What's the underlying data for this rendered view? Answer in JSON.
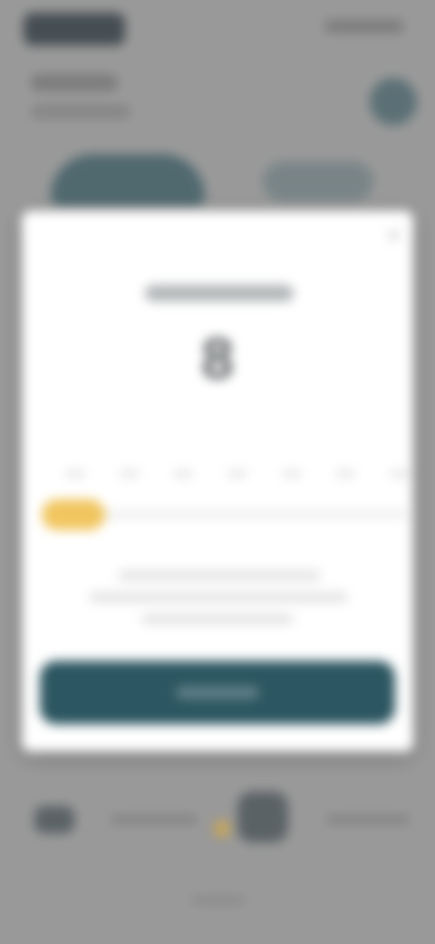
{
  "modal": {
    "value": "8"
  },
  "colors": {
    "primary": "#2c5661",
    "accent": "#f0c04f",
    "modal_bg": "#ffffff",
    "scrim": "#a7a7a7"
  },
  "icons": {
    "close": "close-icon"
  },
  "slider": {
    "position_fraction": 0.0,
    "tick_count": 7
  }
}
